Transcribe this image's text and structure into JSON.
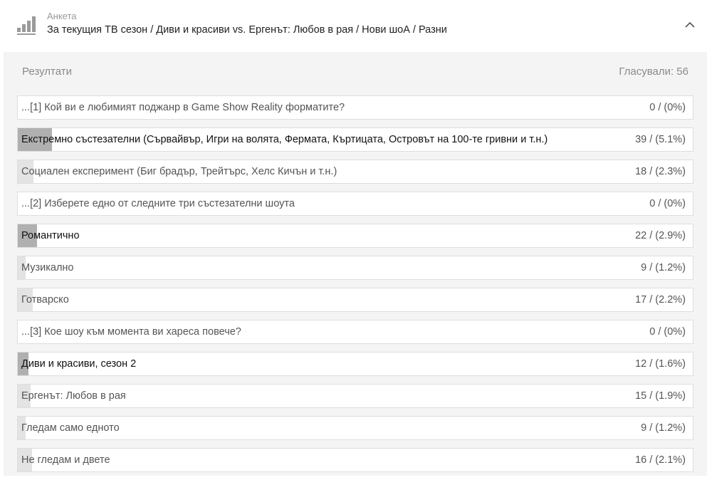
{
  "header": {
    "type_label": "Анкета",
    "title": "За текущия ТВ сезон / Диви и красиви vs. Ергенът: Любов в рая / Нови шоА / Разни",
    "icon": "poll-chart-icon",
    "collapse_icon": "chevron-up-icon"
  },
  "results": {
    "label": "Резултати",
    "voted": "Гласували: 56"
  },
  "rows": [
    {
      "label": "...[1] Кой ви е любимият поджанр в Game Show Reality форматите?",
      "count": "0 / (0%)",
      "share": 0,
      "style": "light"
    },
    {
      "label": "Екстремно състезателни (Сървайвър, Игри на волята, Фермата, Къртицата, Островът на 100-те гривни и т.н.)",
      "count": "39 / (5.1%)",
      "share": 0.051,
      "style": "dark"
    },
    {
      "label": "Социален експеримент (Биг брадър, Трейтърс, Хелс Кичън и т.н.)",
      "count": "18 / (2.3%)",
      "share": 0.023,
      "style": "light"
    },
    {
      "label": "...[2] Изберете едно от следните три състезателни шоута",
      "count": "0 / (0%)",
      "share": 0,
      "style": "light"
    },
    {
      "label": "Романтично",
      "count": "22 / (2.9%)",
      "share": 0.029,
      "style": "dark"
    },
    {
      "label": "Музикално",
      "count": "9 / (1.2%)",
      "share": 0.012,
      "style": "light"
    },
    {
      "label": "Готварско",
      "count": "17 / (2.2%)",
      "share": 0.022,
      "style": "light"
    },
    {
      "label": "...[3] Кое шоу към момента ви хареса повече?",
      "count": "0 / (0%)",
      "share": 0,
      "style": "light"
    },
    {
      "label": "Диви и красиви, сезон 2",
      "count": "12 / (1.6%)",
      "share": 0.016,
      "style": "dark"
    },
    {
      "label": "Ергенът: Любов в рая",
      "count": "15 / (1.9%)",
      "share": 0.019,
      "style": "light"
    },
    {
      "label": "Гледам само едното",
      "count": "9 / (1.2%)",
      "share": 0.012,
      "style": "light"
    },
    {
      "label": "Не гледам и двете",
      "count": "16 / (2.1%)",
      "share": 0.021,
      "style": "light"
    }
  ]
}
